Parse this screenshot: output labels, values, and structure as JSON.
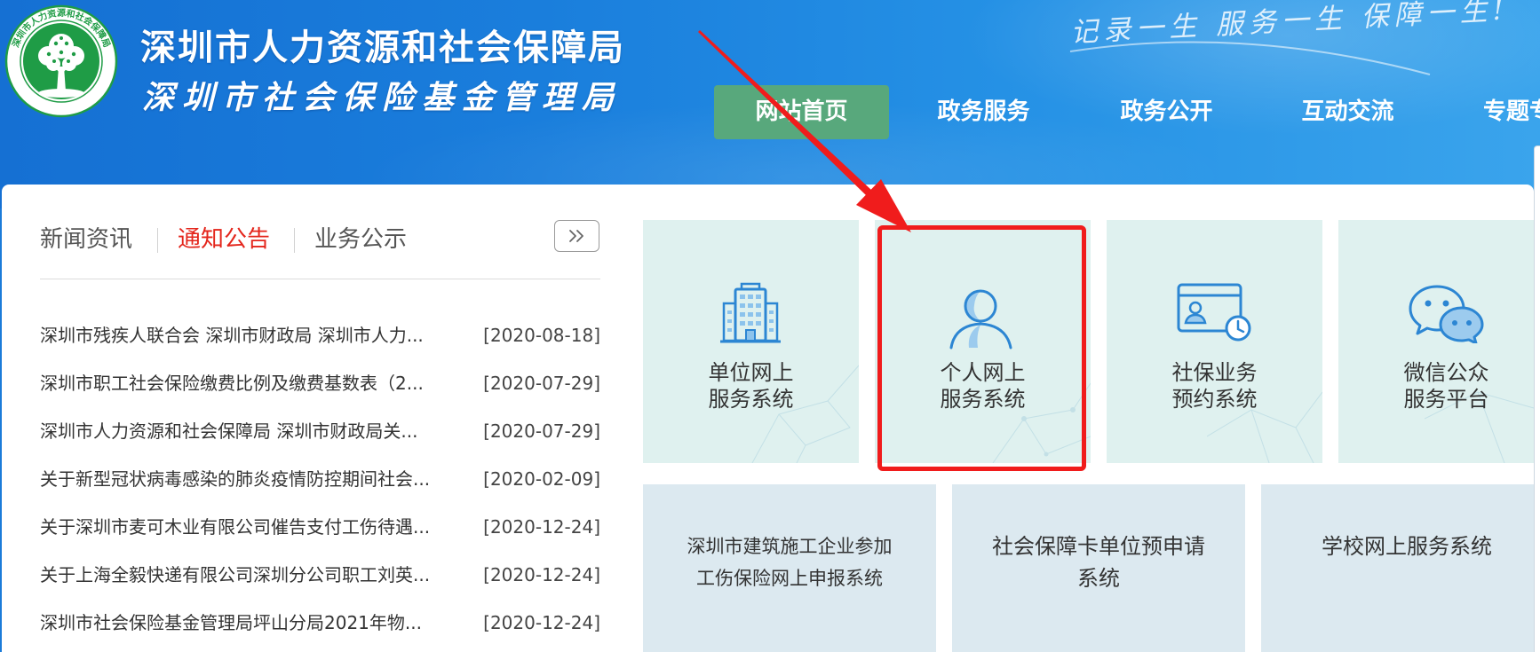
{
  "header": {
    "logo_ring_text": "深圳市人力资源和社会保障局",
    "title": "深圳市人力资源和社会保障局",
    "subtitle": "深圳市社会保险基金管理局",
    "slogan": "记录一生 服务一生 保障一生!",
    "nav": [
      {
        "label": "网站首页",
        "active": true
      },
      {
        "label": "政务服务"
      },
      {
        "label": "政务公开"
      },
      {
        "label": "互动交流"
      },
      {
        "label": "专题专"
      }
    ]
  },
  "news": {
    "tabs": [
      {
        "label": "新闻资讯"
      },
      {
        "label": "通知公告",
        "active": true
      },
      {
        "label": "业务公示"
      }
    ],
    "more_icon": "double-chevron-right-icon",
    "items": [
      {
        "title": "深圳市残疾人联合会 深圳市财政局 深圳市人力...",
        "date": "[2020-08-18]"
      },
      {
        "title": "深圳市职工社会保险缴费比例及缴费基数表（2...",
        "date": "[2020-07-29]"
      },
      {
        "title": "深圳市人力资源和社会保障局 深圳市财政局关...",
        "date": "[2020-07-29]"
      },
      {
        "title": "关于新型冠状病毒感染的肺炎疫情防控期间社会...",
        "date": "[2020-02-09]"
      },
      {
        "title": "关于深圳市麦可木业有限公司催告支付工伤待遇...",
        "date": "[2020-12-24]"
      },
      {
        "title": "关于上海全毅快递有限公司深圳分公司职工刘英...",
        "date": "[2020-12-24]"
      },
      {
        "title": "深圳市社会保险基金管理局坪山分局2021年物...",
        "date": "[2020-12-24]"
      }
    ]
  },
  "services": {
    "primary": [
      {
        "line1": "单位网上",
        "line2": "服务系统",
        "icon": "building-icon"
      },
      {
        "line1": "个人网上",
        "line2": "服务系统",
        "icon": "person-icon",
        "highlighted": true
      },
      {
        "line1": "社保业务",
        "line2": "预约系统",
        "icon": "appointment-calendar-icon"
      },
      {
        "line1": "微信公众",
        "line2": "服务平台",
        "icon": "wechat-icon"
      }
    ],
    "secondary": [
      {
        "line1": "深圳市建筑施工企业参加",
        "line2": "工伤保险网上申报系统"
      },
      {
        "line1": "社会保障卡单位预申请",
        "line2": "系统"
      },
      {
        "line1": "学校网上服务系统"
      }
    ]
  },
  "colors": {
    "header_blue": "#1a7edc",
    "nav_active_bg": "#58a87c",
    "active_tab_red": "#e4251b",
    "tile_primary_bg": "#dff1ef",
    "tile_secondary_bg": "#dce9f0",
    "icon_blue": "#2c86d3",
    "annotation_red": "#f01c1c",
    "logo_green": "#1f9c46"
  }
}
